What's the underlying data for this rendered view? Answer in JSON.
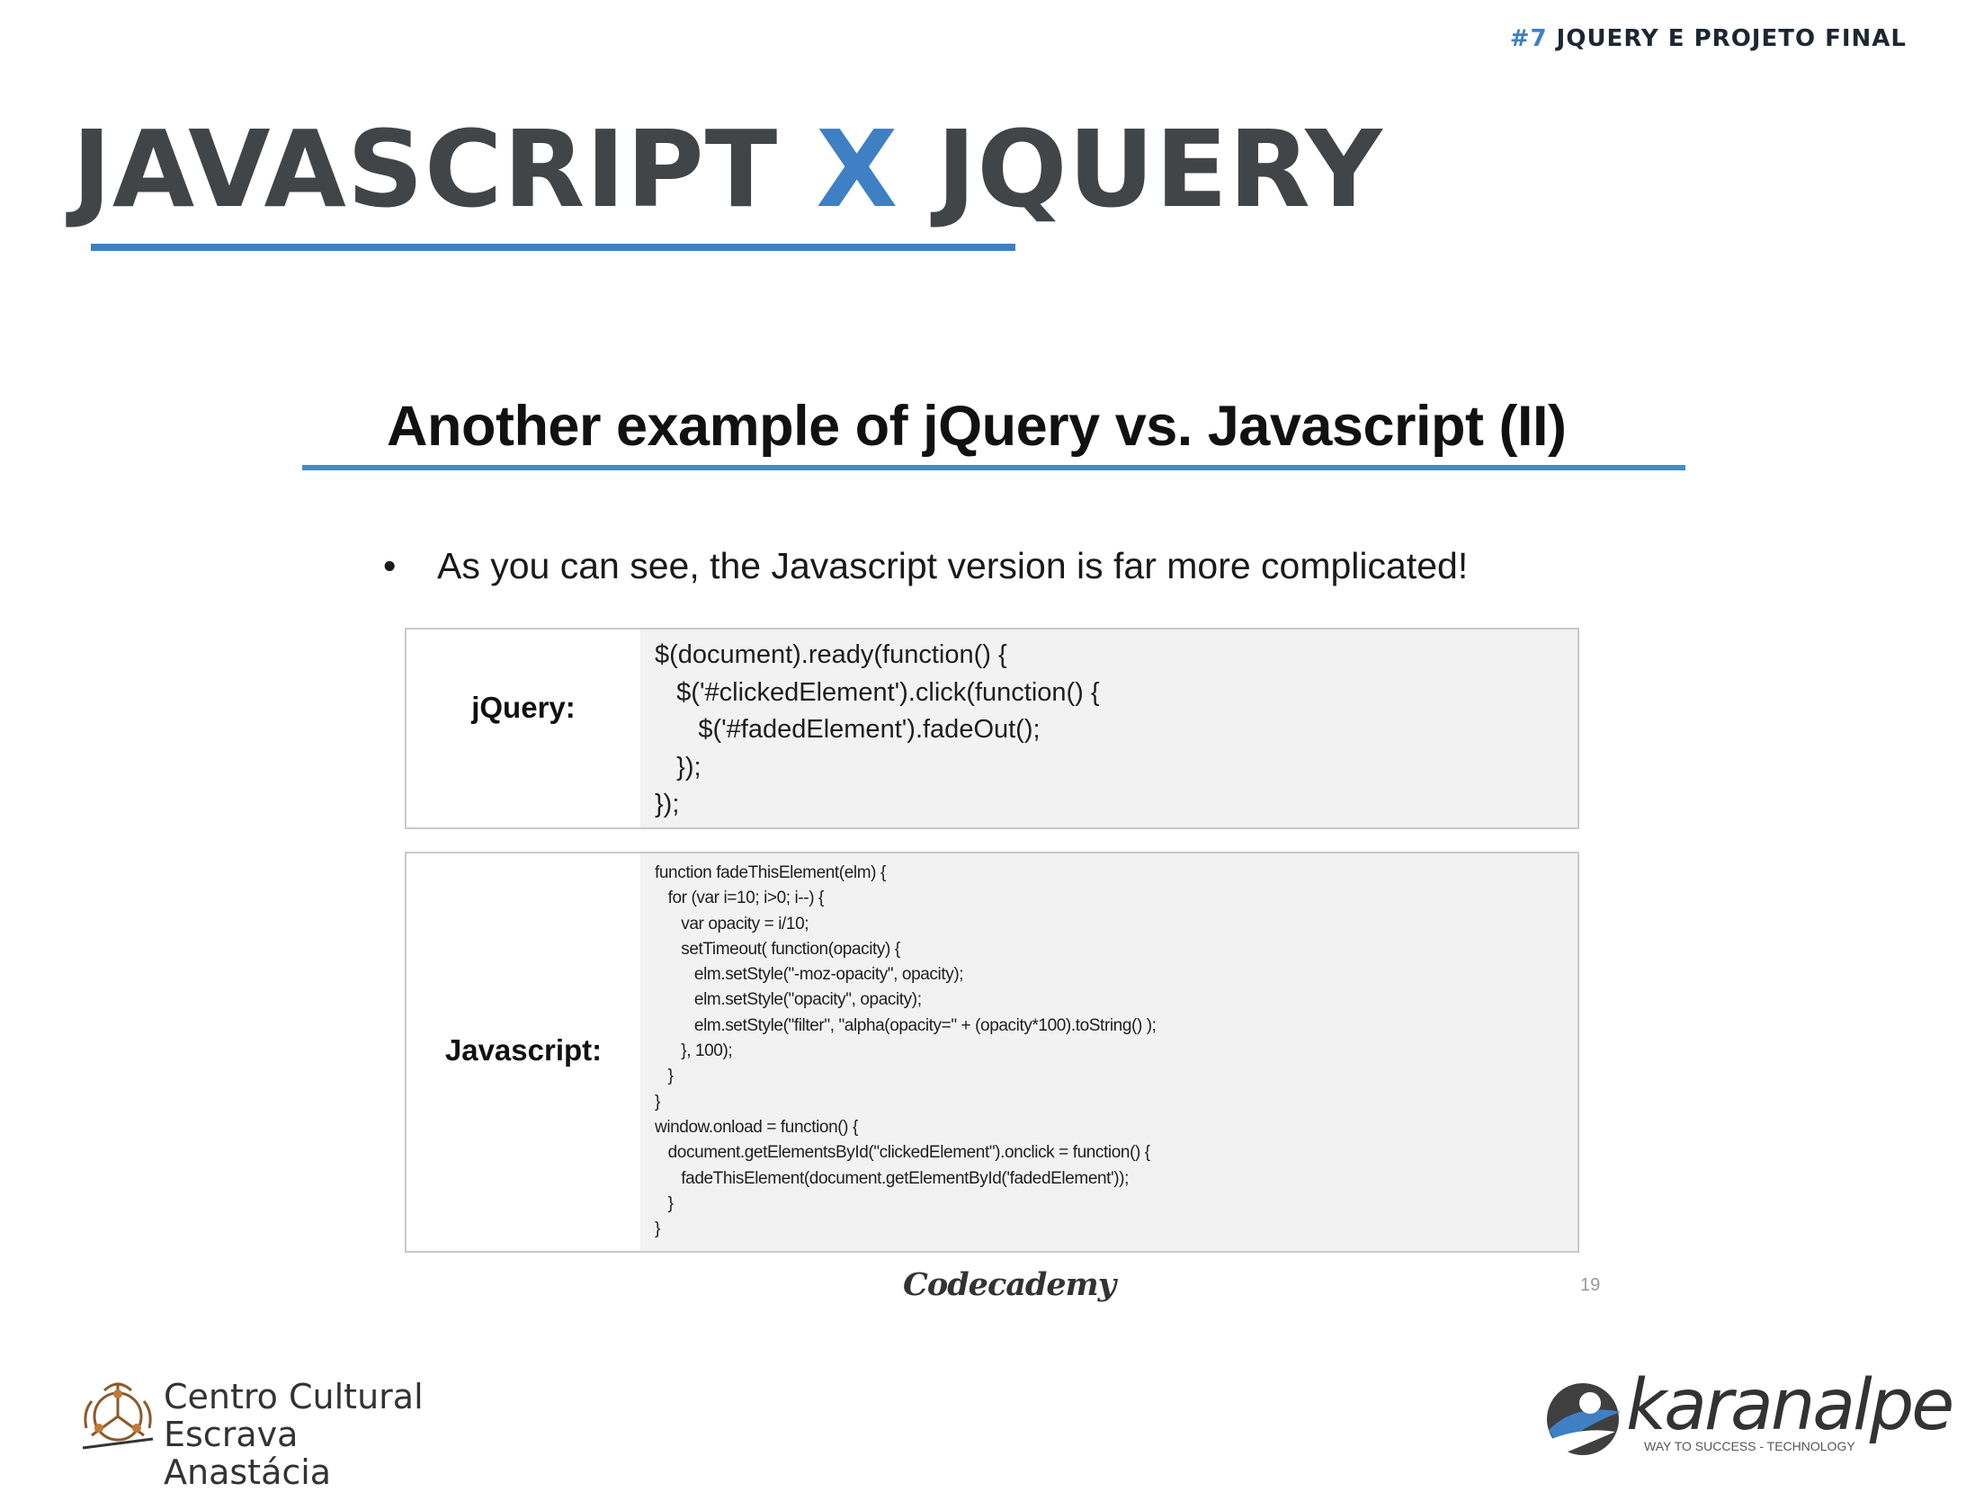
{
  "header": {
    "tag_number": "#7",
    "tag_text": "JQUERY E PROJETO FINAL"
  },
  "title": {
    "part1": "JAVASCRIPT",
    "part2": "X",
    "part3": "JQUERY"
  },
  "slide": {
    "title": "Another example of jQuery vs. Javascript (II)",
    "bullet": "As you can see, the Javascript version is far more complicated!",
    "jquery": {
      "label": "jQuery:",
      "code": "$(document).ready(function() {\n   $('#clickedElement').click(function() {\n      $('#fadedElement').fadeOut();\n   });\n});"
    },
    "javascript": {
      "label": "Javascript:",
      "code": "function fadeThisElement(elm) {\n   for (var i=10; i>0; i--) {\n      var opacity = i/10;\n      setTimeout( function(opacity) {\n         elm.setStyle(\"-moz-opacity\", opacity);\n         elm.setStyle(\"opacity\", opacity);\n         elm.setStyle(\"filter\", \"alpha(opacity=\" + (opacity*100).toString() );\n      }, 100);\n   }\n}\nwindow.onload = function() {\n   document.getElementsById(\"clickedElement\").onclick = function() {\n      fadeThisElement(document.getElementById('fadedElement'));\n   }\n}"
    },
    "source": "Codecademy",
    "page_number": "19"
  },
  "footer": {
    "left_logo_line1": "Centro Cultural",
    "left_logo_line2": "Escrava Anastácia",
    "right_logo_name": "karanalpe",
    "right_logo_tagline": "WAY TO SUCCESS - TECHNOLOGY"
  },
  "colors": {
    "accent": "#3f7fc4",
    "title_gray": "#414547"
  }
}
